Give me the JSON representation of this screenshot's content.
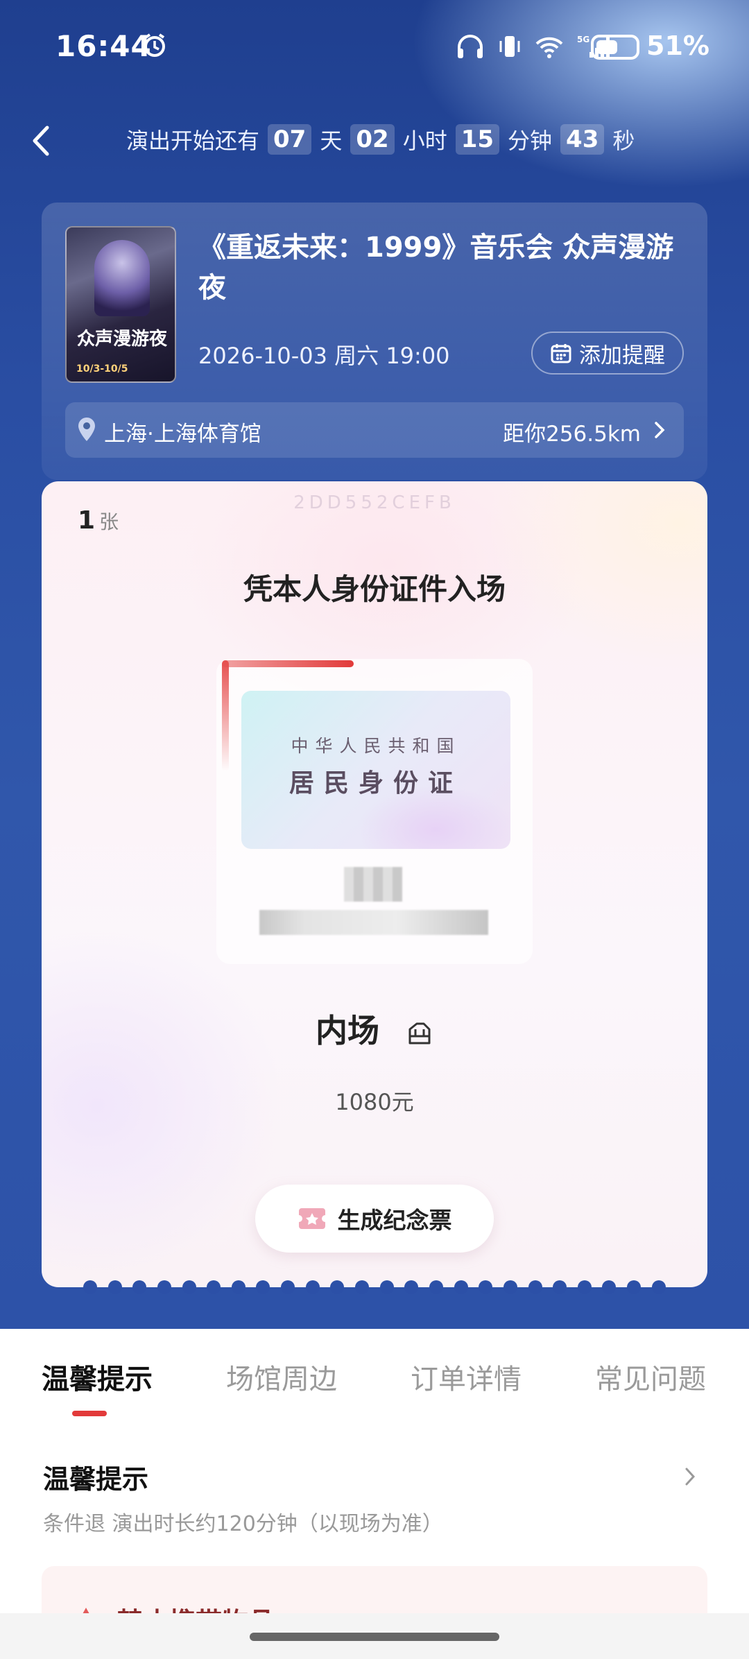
{
  "status_bar": {
    "time": "16:44",
    "battery": "51%",
    "network": "5G"
  },
  "countdown": {
    "prefix": "演出开始还有",
    "days": "07",
    "days_unit": "天",
    "hours": "02",
    "hours_unit": "小时",
    "minutes": "15",
    "minutes_unit": "分钟",
    "seconds": "43",
    "seconds_unit": "秒"
  },
  "event": {
    "title": "《重返未来：1999》音乐会 众声漫游夜",
    "datetime": "2026-10-03 周六 19:00",
    "remind_label": "添加提醒",
    "poster_title": "众声漫游夜",
    "poster_date": "10/3-10/5",
    "venue": "上海·上海体育馆",
    "distance": "距你256.5km"
  },
  "ticket": {
    "code": "2DD552CEFB",
    "quantity": "1",
    "quantity_unit": "张",
    "entry_note": "凭本人身份证件入场",
    "id_line1": "中华人民共和国",
    "id_line2": "居民身份证",
    "area": "内场",
    "price": "1080元",
    "souvenir_button": "生成纪念票"
  },
  "tabs": [
    "温馨提示",
    "场馆周边",
    "订单详情",
    "常见问题"
  ],
  "tips": {
    "heading": "温馨提示",
    "summary": "条件退 演出时长约120分钟（以现场为准）",
    "warning_title": "禁止携带物品"
  },
  "colors": {
    "accent": "#e23a3a",
    "hero_bg": "#2d52a8"
  }
}
